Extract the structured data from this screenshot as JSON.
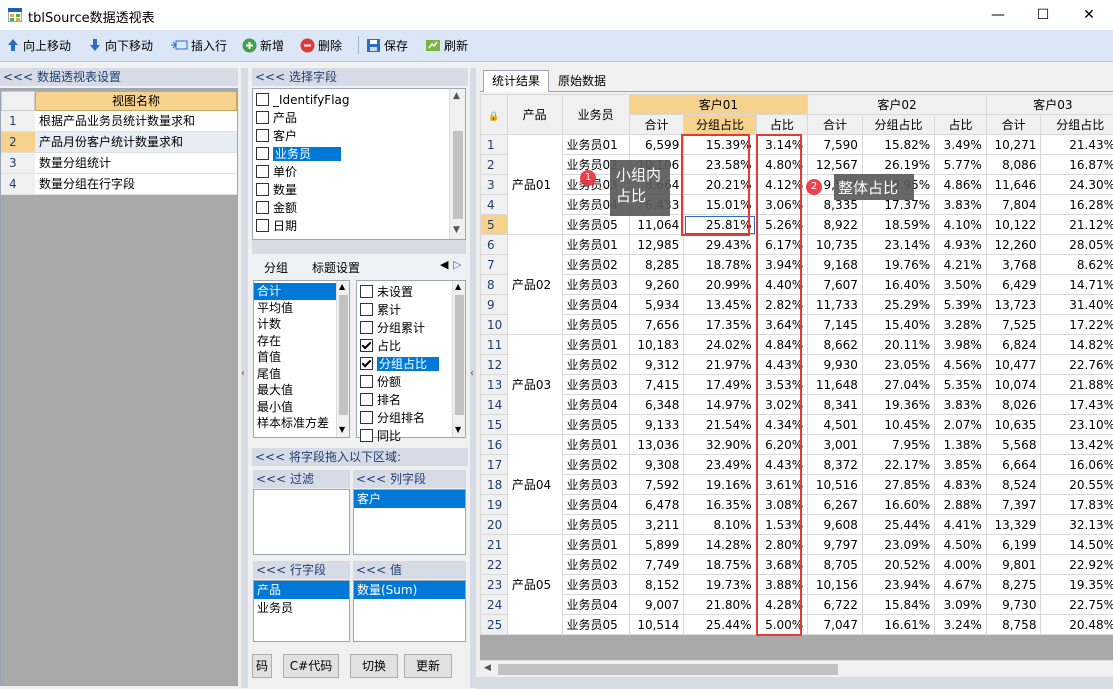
{
  "window": {
    "title": "tblSource数据透视表",
    "min": "—",
    "max": "☐",
    "close": "✕"
  },
  "toolbar": {
    "up": "向上移动",
    "down": "向下移动",
    "insert": "插入行",
    "add": "新增",
    "delete": "删除",
    "save": "保存",
    "refresh": "刷新"
  },
  "left_panel": {
    "header": "<<< 数据透视表设置",
    "col_header": "视图名称",
    "rows": [
      {
        "n": "1",
        "name": "根据产品业务员统计数量求和"
      },
      {
        "n": "2",
        "name": "产品月份客户统计数量求和"
      },
      {
        "n": "3",
        "name": "数量分组统计"
      },
      {
        "n": "4",
        "name": "数量分组在行字段"
      }
    ]
  },
  "field_panel": {
    "header": "<<< 选择字段",
    "fields": [
      "_IdentifyFlag",
      "产品",
      "客户",
      "业务员",
      "单价",
      "数量",
      "金额",
      "日期"
    ],
    "selected": "业务员"
  },
  "group_tabs": {
    "tab1": "分组",
    "tab2": "标题设置"
  },
  "agg_list": [
    "合计",
    "平均值",
    "计数",
    "存在",
    "首值",
    "尾值",
    "最大值",
    "最小值",
    "样本标准方差"
  ],
  "opt_list": [
    {
      "label": "未设置",
      "checked": false
    },
    {
      "label": "累计",
      "checked": false
    },
    {
      "label": "分组累计",
      "checked": false
    },
    {
      "label": "占比",
      "checked": true
    },
    {
      "label": "分组占比",
      "checked": true
    },
    {
      "label": "份额",
      "checked": false
    },
    {
      "label": "排名",
      "checked": false
    },
    {
      "label": "分组排名",
      "checked": false
    },
    {
      "label": "同比",
      "checked": false
    }
  ],
  "drag_area": {
    "header": "<<< 将字段拖入以下区域:",
    "filter": "<<< 过滤",
    "col_field": "<<< 列字段",
    "col_items": [
      "客户"
    ],
    "row_field": "<<< 行字段",
    "row_items": [
      "产品",
      "业务员"
    ],
    "values": "<<< 值",
    "value_items": [
      "数量(Sum)"
    ]
  },
  "buttons": {
    "code_prev": "码",
    "csharp": "C#代码",
    "switch": "切换",
    "update": "更新"
  },
  "tabs": {
    "result": "统计结果",
    "raw": "原始数据"
  },
  "grid": {
    "h_product": "产品",
    "h_sales": "业务员",
    "customers": [
      "客户01",
      "客户02",
      "客户03"
    ],
    "sub": [
      "合计",
      "分组占比",
      "占比"
    ],
    "rows": [
      [
        "1",
        "产品01",
        "业务员01",
        "6,599",
        "15.39%",
        "3.14%",
        "7,590",
        "15.82%",
        "3.49%",
        "10,271",
        "21.43%"
      ],
      [
        "2",
        "",
        "业务员02",
        "10,106",
        "23.58%",
        "4.80%",
        "12,567",
        "26.19%",
        "5.77%",
        "8,086",
        "16.87%"
      ],
      [
        "3",
        "",
        "业务员03",
        "8,664",
        "20.21%",
        "4.12%",
        "9,574",
        "19.95%",
        "4.86%",
        "11,646",
        "24.30%"
      ],
      [
        "4",
        "",
        "业务员04",
        "6,433",
        "15.01%",
        "3.06%",
        "8,335",
        "17.37%",
        "3.83%",
        "7,804",
        "16.28%"
      ],
      [
        "5",
        "",
        "业务员05",
        "11,064",
        "25.81%",
        "5.26%",
        "8,922",
        "18.59%",
        "4.10%",
        "10,122",
        "21.12%"
      ],
      [
        "6",
        "产品02",
        "业务员01",
        "12,985",
        "29.43%",
        "6.17%",
        "10,735",
        "23.14%",
        "4.93%",
        "12,260",
        "28.05%"
      ],
      [
        "7",
        "",
        "业务员02",
        "8,285",
        "18.78%",
        "3.94%",
        "9,168",
        "19.76%",
        "4.21%",
        "3,768",
        "8.62%"
      ],
      [
        "8",
        "",
        "业务员03",
        "9,260",
        "20.99%",
        "4.40%",
        "7,607",
        "16.40%",
        "3.50%",
        "6,429",
        "14.71%"
      ],
      [
        "9",
        "",
        "业务员04",
        "5,934",
        "13.45%",
        "2.82%",
        "11,733",
        "25.29%",
        "5.39%",
        "13,723",
        "31.40%"
      ],
      [
        "10",
        "",
        "业务员05",
        "7,656",
        "17.35%",
        "3.64%",
        "7,145",
        "15.40%",
        "3.28%",
        "7,525",
        "17.22%"
      ],
      [
        "11",
        "产品03",
        "业务员01",
        "10,183",
        "24.02%",
        "4.84%",
        "8,662",
        "20.11%",
        "3.98%",
        "6,824",
        "14.82%"
      ],
      [
        "12",
        "",
        "业务员02",
        "9,312",
        "21.97%",
        "4.43%",
        "9,930",
        "23.05%",
        "4.56%",
        "10,477",
        "22.76%"
      ],
      [
        "13",
        "",
        "业务员03",
        "7,415",
        "17.49%",
        "3.53%",
        "11,648",
        "27.04%",
        "5.35%",
        "10,074",
        "21.88%"
      ],
      [
        "14",
        "",
        "业务员04",
        "6,348",
        "14.97%",
        "3.02%",
        "8,341",
        "19.36%",
        "3.83%",
        "8,026",
        "17.43%"
      ],
      [
        "15",
        "",
        "业务员05",
        "9,133",
        "21.54%",
        "4.34%",
        "4,501",
        "10.45%",
        "2.07%",
        "10,635",
        "23.10%"
      ],
      [
        "16",
        "产品04",
        "业务员01",
        "13,036",
        "32.90%",
        "6.20%",
        "3,001",
        "7.95%",
        "1.38%",
        "5,568",
        "13.42%"
      ],
      [
        "17",
        "",
        "业务员02",
        "9,308",
        "23.49%",
        "4.43%",
        "8,372",
        "22.17%",
        "3.85%",
        "6,664",
        "16.06%"
      ],
      [
        "18",
        "",
        "业务员03",
        "7,592",
        "19.16%",
        "3.61%",
        "10,516",
        "27.85%",
        "4.83%",
        "8,524",
        "20.55%"
      ],
      [
        "19",
        "",
        "业务员04",
        "6,478",
        "16.35%",
        "3.08%",
        "6,267",
        "16.60%",
        "2.88%",
        "7,397",
        "17.83%"
      ],
      [
        "20",
        "",
        "业务员05",
        "3,211",
        "8.10%",
        "1.53%",
        "9,608",
        "25.44%",
        "4.41%",
        "13,329",
        "32.13%"
      ],
      [
        "21",
        "产品05",
        "业务员01",
        "5,899",
        "14.28%",
        "2.80%",
        "9,797",
        "23.09%",
        "4.50%",
        "6,199",
        "14.50%"
      ],
      [
        "22",
        "",
        "业务员02",
        "7,749",
        "18.75%",
        "3.68%",
        "8,705",
        "20.52%",
        "4.00%",
        "9,801",
        "22.92%"
      ],
      [
        "23",
        "",
        "业务员03",
        "8,152",
        "19.73%",
        "3.88%",
        "10,156",
        "23.94%",
        "4.67%",
        "8,275",
        "19.35%"
      ],
      [
        "24",
        "",
        "业务员04",
        "9,007",
        "21.80%",
        "4.28%",
        "6,722",
        "15.84%",
        "3.09%",
        "9,730",
        "22.75%"
      ],
      [
        "25",
        "",
        "业务员05",
        "10,514",
        "25.44%",
        "5.00%",
        "7,047",
        "16.61%",
        "3.24%",
        "8,758",
        "20.48%"
      ]
    ]
  },
  "callouts": {
    "badge1": "1",
    "text1a": "小组内",
    "text1b": "占比",
    "badge2": "2",
    "text2": "整体占比"
  },
  "colors": {
    "accent": "#0078d7",
    "highlight_header": "#f7d28c",
    "box_red": "#e53935"
  }
}
